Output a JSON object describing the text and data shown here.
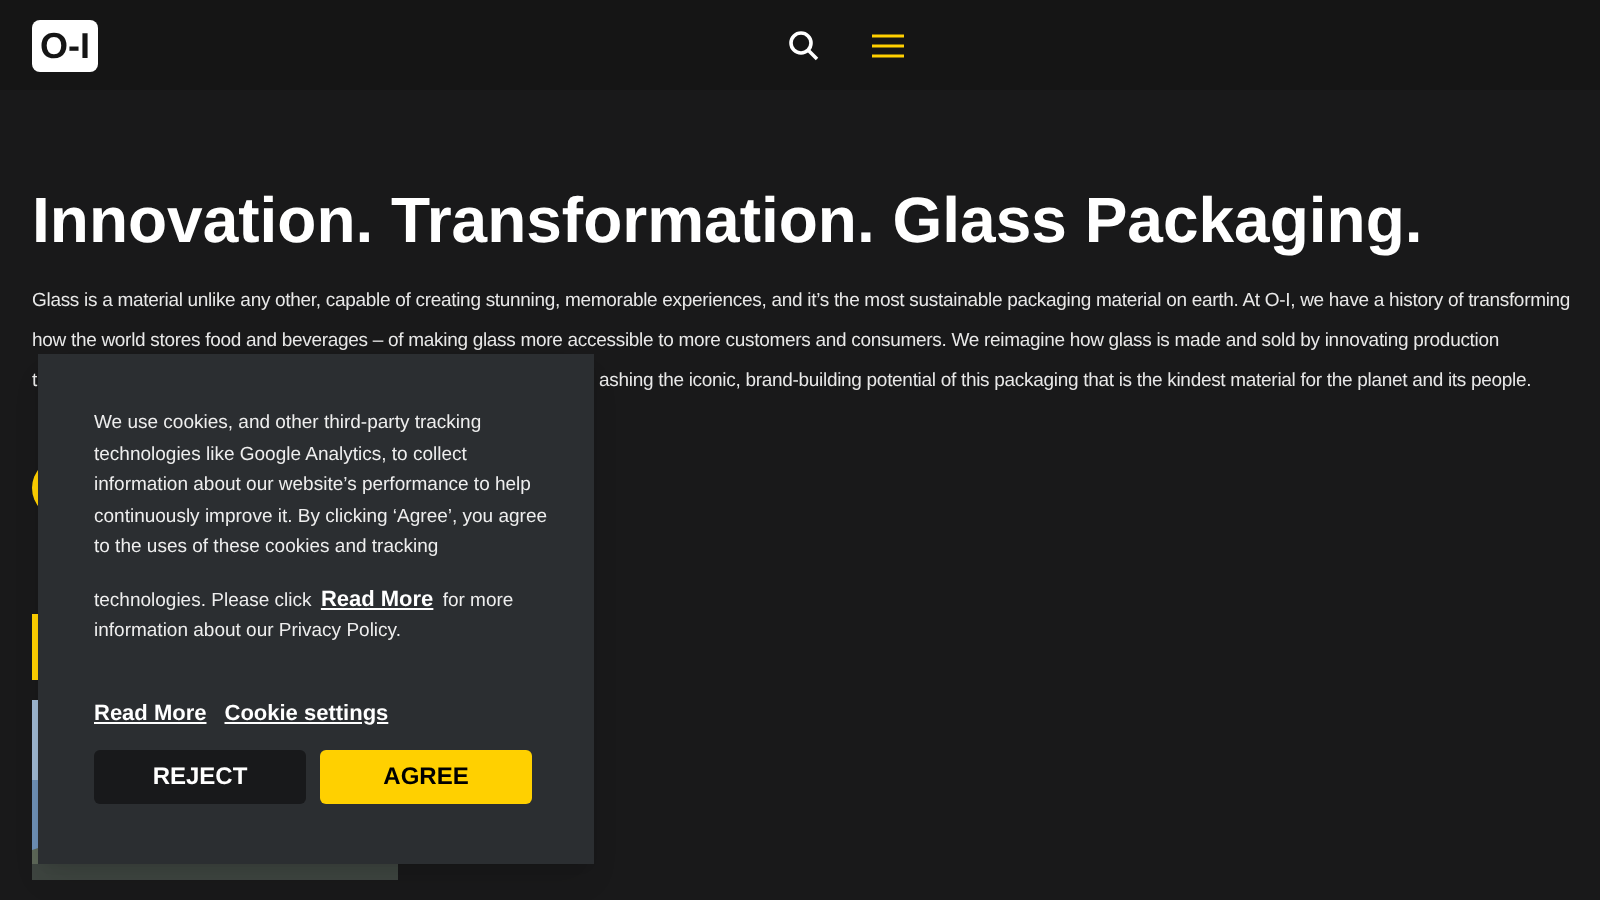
{
  "header": {
    "logo": "O-I"
  },
  "hero": {
    "title": "Innovation. Transformation. Glass Packaging.",
    "lines": [
      "Glass is a material unlike any other, capable of creating stunning, memorable experiences, and it’s the most sustainable packaging material on earth. At O-I, we have a history of transforming",
      "how the world stores food and beverages – of making glass more accessible to more customers and consumers. We reimagine how glass is made and sold by innovating production"
    ],
    "line_start": "t",
    "line_end": "ashing the iconic, brand-building potential of this packaging that is the kindest material for the planet and its people."
  },
  "cookie_banner": {
    "text_1": "We use cookies, and other third-party tracking technologies like Google Analytics, to collect information about our website’s performance to help continuously improve it. By clicking ‘Agree’, you agree to the uses of these cookies and tracking",
    "text_2_before": "technologies. Please click",
    "text_2_link": "Read More",
    "text_2_after": "for more information about our Privacy Policy.",
    "links": [
      "Read More",
      "Cookie settings"
    ],
    "buttons": [
      {
        "label": "REJECT",
        "kind": "secondary"
      },
      {
        "label": "AGREE",
        "kind": "primary"
      }
    ]
  }
}
